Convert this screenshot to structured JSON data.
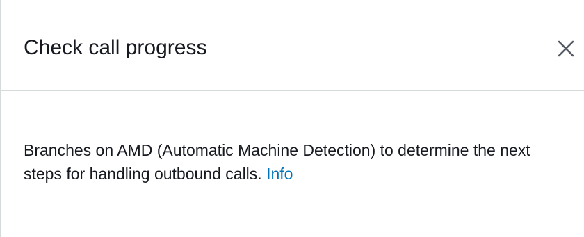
{
  "panel": {
    "title": "Check call progress",
    "close_icon": "close-icon",
    "description": "Branches on AMD (Automatic Machine Detection) to determine the next steps for handling outbound calls.",
    "info_link": "Info"
  },
  "colors": {
    "link": "#0073bb",
    "text": "#16191f",
    "divider": "#d5dbdb"
  }
}
